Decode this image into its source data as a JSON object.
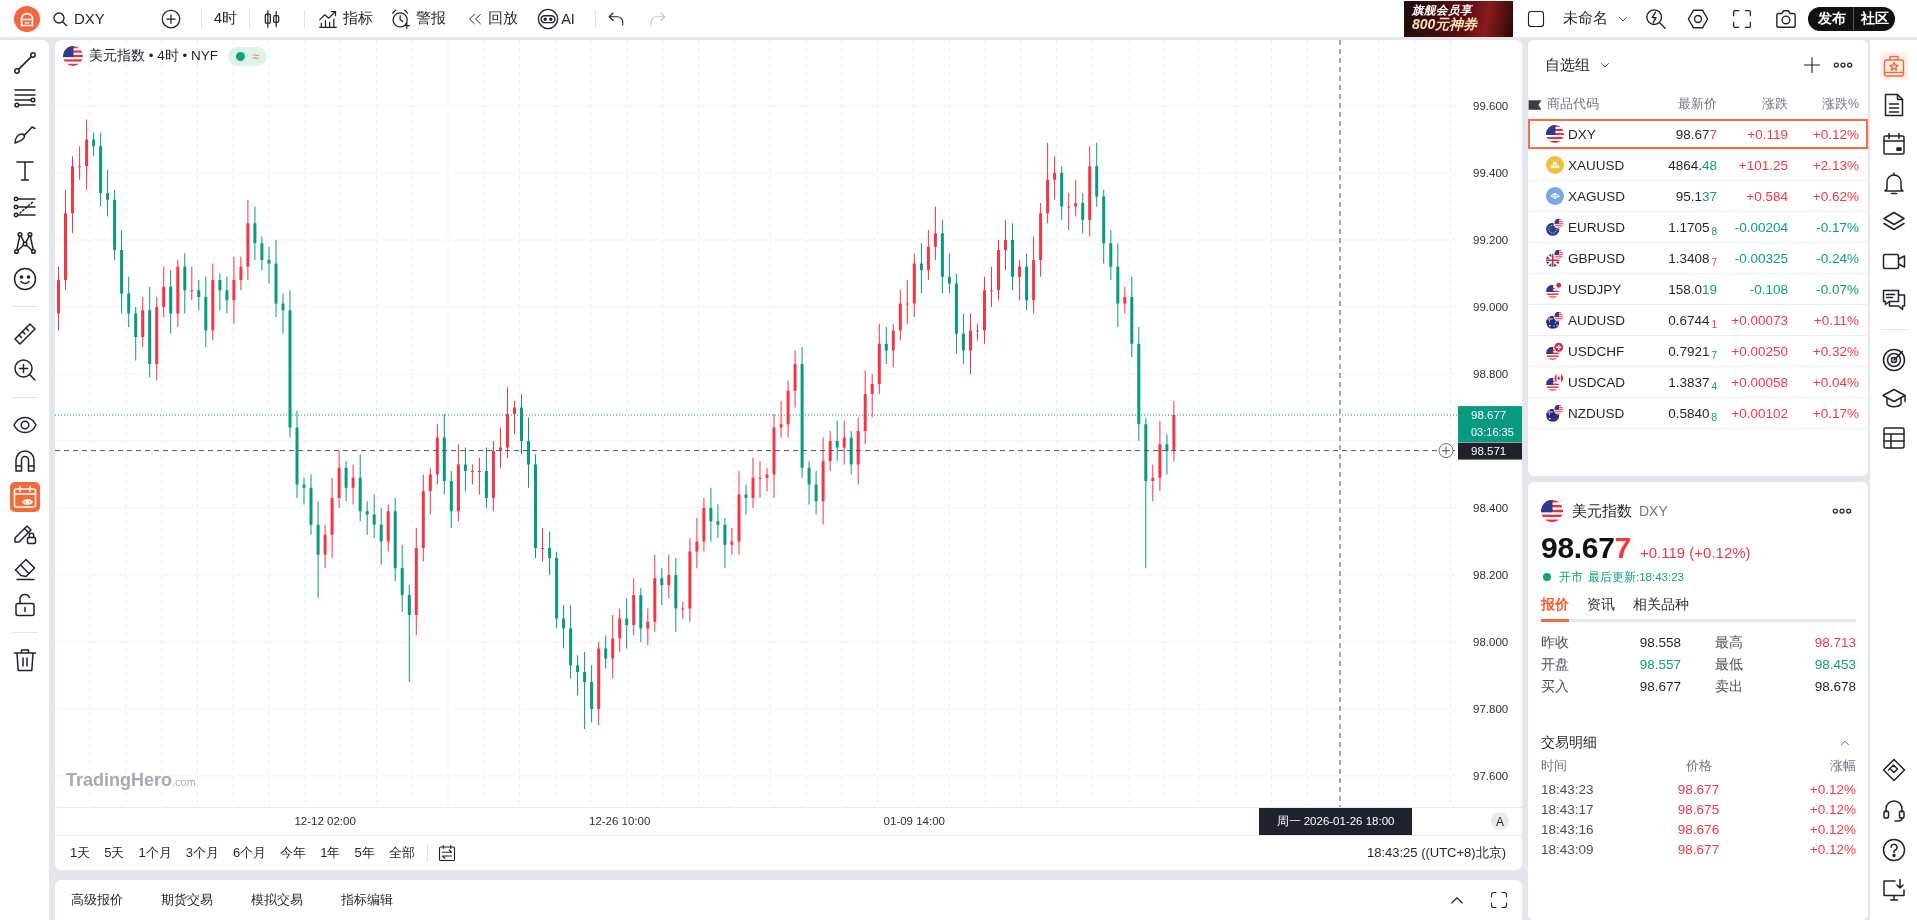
{
  "top_bar": {
    "search": {
      "value": "DXY"
    },
    "interval": "4时",
    "tools": [
      {
        "kind": "indicators",
        "label": "指标"
      },
      {
        "kind": "alerts",
        "label": "警报"
      },
      {
        "kind": "replay",
        "label": "回放"
      },
      {
        "kind": "assistant",
        "label": "AI"
      }
    ],
    "history": [
      {
        "kind": "undo",
        "disabled": false
      },
      {
        "kind": "redo",
        "disabled": true
      }
    ],
    "banner": {
      "line_1": "旗舰会员享",
      "line_2": "800元神券"
    },
    "layout_name": "未命名",
    "actions": [
      "发布",
      "社区"
    ]
  },
  "left_toolbar": {
    "groups": [
      {
        "tools": [
          {
            "kind": "line",
            "selected": false
          },
          {
            "kind": "channels",
            "selected": false
          },
          {
            "kind": "brush",
            "selected": false
          },
          {
            "kind": "text",
            "selected": false
          },
          {
            "kind": "levels",
            "selected": false
          },
          {
            "kind": "pattern",
            "selected": false
          },
          {
            "kind": "emoji",
            "selected": false
          }
        ]
      },
      {
        "tools": [
          {
            "kind": "ruler",
            "selected": false
          },
          {
            "kind": "zoom",
            "selected": false
          }
        ]
      },
      {
        "tools": [
          {
            "kind": "visibility",
            "selected": false
          },
          {
            "kind": "magnet",
            "selected": false
          },
          {
            "kind": "events",
            "selected": true
          },
          {
            "kind": "lockdraw",
            "selected": false
          },
          {
            "kind": "eraser",
            "selected": false
          },
          {
            "kind": "unlock",
            "selected": false
          }
        ]
      },
      {
        "tools": [
          {
            "kind": "trash",
            "selected": false
          }
        ]
      }
    ]
  },
  "chart": {
    "legend": {
      "title": "美元指数 • 4时 • NYF",
      "market_open": true,
      "badge": "≈"
    },
    "brand": "**TradingHero**.com",
    "chart_data": {
      "type": "candlestick",
      "grid": true,
      "categories": [
        null,
        null,
        null,
        null,
        null,
        null,
        null,
        null,
        null,
        null,
        null,
        null,
        null,
        null,
        null,
        null,
        null,
        null,
        null,
        null,
        null,
        null,
        null,
        null,
        null,
        null,
        null,
        null,
        null,
        null,
        null,
        null,
        null,
        null,
        null,
        null,
        null,
        null,
        "12-12 02:00",
        null,
        null,
        null,
        null,
        null,
        null,
        null,
        null,
        null,
        null,
        null,
        null,
        null,
        null,
        null,
        null,
        null,
        null,
        null,
        null,
        null,
        null,
        null,
        null,
        null,
        null,
        null,
        null,
        null,
        null,
        null,
        null,
        null,
        null,
        null,
        null,
        null,
        null,
        null,
        null,
        null,
        "12-26 10:00",
        null,
        null,
        null,
        null,
        null,
        null,
        null,
        null,
        null,
        null,
        null,
        null,
        null,
        null,
        null,
        null,
        null,
        null,
        null,
        null,
        null,
        null,
        null,
        null,
        null,
        null,
        null,
        null,
        null,
        null,
        null,
        null,
        null,
        null,
        null,
        null,
        null,
        null,
        null,
        null,
        null,
        "01-09 14:00",
        null,
        null,
        null,
        null,
        null,
        null,
        null,
        null,
        null,
        null,
        null,
        null,
        null,
        null,
        null,
        null,
        null,
        null,
        null,
        null,
        null,
        null,
        null,
        null,
        null,
        null,
        null,
        null,
        null,
        null,
        null,
        null,
        null,
        null,
        null,
        null,
        null,
        null,
        null,
        null,
        null,
        null,
        null,
        null,
        null,
        null,
        null,
        null,
        null,
        null,
        null,
        null,
        null,
        null,
        null,
        null,
        null,
        null,
        null,
        null,
        null,
        null,
        null,
        null,
        null,
        null,
        null,
        null,
        null,
        null,
        null,
        null,
        null,
        null,
        null,
        null,
        null
      ],
      "ohlc": [
        [
          98.98,
          99.12,
          98.93,
          99.08
        ],
        [
          99.08,
          99.35,
          99.05,
          99.28
        ],
        [
          99.28,
          99.45,
          99.22,
          99.42
        ],
        [
          99.42,
          99.48,
          99.38,
          99.42
        ],
        [
          99.42,
          99.56,
          99.35,
          99.5
        ],
        [
          99.5,
          99.52,
          99.45,
          99.48
        ],
        [
          99.48,
          99.52,
          99.3,
          99.34
        ],
        [
          99.34,
          99.41,
          99.27,
          99.32
        ],
        [
          99.32,
          99.35,
          99.14,
          99.17
        ],
        [
          99.17,
          99.23,
          98.98,
          99.04
        ],
        [
          99.04,
          99.09,
          98.94,
          98.98
        ],
        [
          98.98,
          99.0,
          98.84,
          98.91
        ],
        [
          98.91,
          99.03,
          98.88,
          98.99
        ],
        [
          98.99,
          99.06,
          98.79,
          98.83
        ],
        [
          98.83,
          99.03,
          98.78,
          99.0
        ],
        [
          99.0,
          99.12,
          98.97,
          99.06
        ],
        [
          99.06,
          99.11,
          98.92,
          98.98
        ],
        [
          98.98,
          99.14,
          98.94,
          99.12
        ],
        [
          99.12,
          99.16,
          98.98,
          99.05
        ],
        [
          99.05,
          99.12,
          99.02,
          99.05
        ],
        [
          99.05,
          99.08,
          98.99,
          99.03
        ],
        [
          99.03,
          99.09,
          98.88,
          98.93
        ],
        [
          98.93,
          99.13,
          98.9,
          99.08
        ],
        [
          99.08,
          99.1,
          98.99,
          99.05
        ],
        [
          99.05,
          99.09,
          98.98,
          99.02
        ],
        [
          99.02,
          99.15,
          98.95,
          99.08
        ],
        [
          99.08,
          99.15,
          99.05,
          99.12
        ],
        [
          99.12,
          99.32,
          99.08,
          99.25
        ],
        [
          99.25,
          99.3,
          99.14,
          99.19
        ],
        [
          99.19,
          99.21,
          99.11,
          99.14
        ],
        [
          99.14,
          99.18,
          99.07,
          99.13
        ],
        [
          99.13,
          99.2,
          98.97,
          99.01
        ],
        [
          99.01,
          99.04,
          98.92,
          98.99
        ],
        [
          98.99,
          99.05,
          98.61,
          98.64
        ],
        [
          98.64,
          98.69,
          98.43,
          98.47
        ],
        [
          98.47,
          98.49,
          98.41,
          98.46
        ],
        [
          98.46,
          98.5,
          98.32,
          98.35
        ],
        [
          98.35,
          98.42,
          98.13,
          98.26
        ],
        [
          98.26,
          98.35,
          98.22,
          98.32
        ],
        [
          98.32,
          98.49,
          98.25,
          98.43
        ],
        [
          98.43,
          98.57,
          98.4,
          98.52
        ],
        [
          98.52,
          98.54,
          98.42,
          98.46
        ],
        [
          98.46,
          98.53,
          98.41,
          98.49
        ],
        [
          98.49,
          98.56,
          98.36,
          98.39
        ],
        [
          98.39,
          98.42,
          98.32,
          98.38
        ],
        [
          98.38,
          98.44,
          98.31,
          98.35
        ],
        [
          98.35,
          98.4,
          98.23,
          98.3
        ],
        [
          98.3,
          98.41,
          98.27,
          98.39
        ],
        [
          98.39,
          98.43,
          98.18,
          98.22
        ],
        [
          98.22,
          98.29,
          98.09,
          98.14
        ],
        [
          98.14,
          98.17,
          97.88,
          98.08
        ],
        [
          98.08,
          98.34,
          98.02,
          98.28
        ],
        [
          98.28,
          98.5,
          98.24,
          98.45
        ],
        [
          98.45,
          98.52,
          98.38,
          98.5
        ],
        [
          98.5,
          98.65,
          98.47,
          98.61
        ],
        [
          98.61,
          98.68,
          98.44,
          98.48
        ],
        [
          98.48,
          98.51,
          98.34,
          98.39
        ],
        [
          98.39,
          98.59,
          98.36,
          98.53
        ],
        [
          98.53,
          98.58,
          98.45,
          98.51
        ],
        [
          98.51,
          98.53,
          98.47,
          98.51
        ],
        [
          98.51,
          98.55,
          98.44,
          98.51
        ],
        [
          98.51,
          98.58,
          98.4,
          98.43
        ],
        [
          98.43,
          98.6,
          98.39,
          98.57
        ],
        [
          98.57,
          98.64,
          98.52,
          98.58
        ],
        [
          98.58,
          98.76,
          98.55,
          98.68
        ],
        [
          98.68,
          98.72,
          98.62,
          98.7
        ],
        [
          98.7,
          98.74,
          98.56,
          98.6
        ],
        [
          98.6,
          98.67,
          98.46,
          98.53
        ],
        [
          98.53,
          98.56,
          98.25,
          98.28
        ],
        [
          98.28,
          98.34,
          98.24,
          98.28
        ],
        [
          98.28,
          98.33,
          98.2,
          98.25
        ],
        [
          98.25,
          98.27,
          98.04,
          98.07
        ],
        [
          98.07,
          98.11,
          97.98,
          98.04
        ],
        [
          98.04,
          98.11,
          97.89,
          97.93
        ],
        [
          97.93,
          97.96,
          97.84,
          97.91
        ],
        [
          97.91,
          97.97,
          97.74,
          97.88
        ],
        [
          97.88,
          97.93,
          97.76,
          97.8
        ],
        [
          97.8,
          98.0,
          97.75,
          97.98
        ],
        [
          97.98,
          98.02,
          97.92,
          97.95
        ],
        [
          97.95,
          98.08,
          97.89,
          98.01
        ],
        [
          98.01,
          98.1,
          97.97,
          98.07
        ],
        [
          98.07,
          98.13,
          97.98,
          98.05
        ],
        [
          98.05,
          98.19,
          98.02,
          98.14
        ],
        [
          98.14,
          98.16,
          98.0,
          98.04
        ],
        [
          98.04,
          98.1,
          97.99,
          98.06
        ],
        [
          98.06,
          98.26,
          98.03,
          98.19
        ],
        [
          98.19,
          98.22,
          98.11,
          98.17
        ],
        [
          98.17,
          98.26,
          98.13,
          98.2
        ],
        [
          98.2,
          98.25,
          98.03,
          98.1
        ],
        [
          98.1,
          98.12,
          98.07,
          98.1
        ],
        [
          98.1,
          98.31,
          98.06,
          98.27
        ],
        [
          98.27,
          98.37,
          98.22,
          98.3
        ],
        [
          98.3,
          98.43,
          98.27,
          98.4
        ],
        [
          98.4,
          98.46,
          98.3,
          98.36
        ],
        [
          98.36,
          98.41,
          98.31,
          98.35
        ],
        [
          98.35,
          98.37,
          98.22,
          98.29
        ],
        [
          98.29,
          98.34,
          98.26,
          98.3
        ],
        [
          98.3,
          98.51,
          98.26,
          98.44
        ],
        [
          98.44,
          98.47,
          98.38,
          98.43
        ],
        [
          98.43,
          98.55,
          98.4,
          98.49
        ],
        [
          98.49,
          98.54,
          98.43,
          98.49
        ],
        [
          98.49,
          98.52,
          98.45,
          98.5
        ],
        [
          98.5,
          98.68,
          98.43,
          98.64
        ],
        [
          98.64,
          98.72,
          98.61,
          98.65
        ],
        [
          98.65,
          98.78,
          98.61,
          98.75
        ],
        [
          98.75,
          98.87,
          98.7,
          98.83
        ],
        [
          98.83,
          98.88,
          98.49,
          98.52
        ],
        [
          98.52,
          98.54,
          98.41,
          98.47
        ],
        [
          98.47,
          98.51,
          98.38,
          98.42
        ],
        [
          98.42,
          98.61,
          98.35,
          98.54
        ],
        [
          98.54,
          98.63,
          98.51,
          98.6
        ],
        [
          98.6,
          98.66,
          98.54,
          98.58
        ],
        [
          98.58,
          98.66,
          98.53,
          98.61
        ],
        [
          98.61,
          98.63,
          98.5,
          98.53
        ],
        [
          98.53,
          98.67,
          98.47,
          98.63
        ],
        [
          98.63,
          98.81,
          98.59,
          98.74
        ],
        [
          98.74,
          98.8,
          98.67,
          98.77
        ],
        [
          98.77,
          98.95,
          98.74,
          98.89
        ],
        [
          98.89,
          98.94,
          98.83,
          98.87
        ],
        [
          98.87,
          98.95,
          98.82,
          98.93
        ],
        [
          98.93,
          99.05,
          98.9,
          99.01
        ],
        [
          99.01,
          99.08,
          98.95,
          99.01
        ],
        [
          99.01,
          99.16,
          98.97,
          99.13
        ],
        [
          99.13,
          99.19,
          99.04,
          99.11
        ],
        [
          99.11,
          99.23,
          99.08,
          99.18
        ],
        [
          99.18,
          99.3,
          99.14,
          99.22
        ],
        [
          99.22,
          99.26,
          99.04,
          99.09
        ],
        [
          99.09,
          99.16,
          99.04,
          99.07
        ],
        [
          99.07,
          99.1,
          98.86,
          98.92
        ],
        [
          98.92,
          98.98,
          98.83,
          98.87
        ],
        [
          98.87,
          98.98,
          98.8,
          98.93
        ],
        [
          98.93,
          98.95,
          98.9,
          98.93
        ],
        [
          98.93,
          99.09,
          98.89,
          99.05
        ],
        [
          99.05,
          99.12,
          99.0,
          99.05
        ],
        [
          99.05,
          99.2,
          99.02,
          99.17
        ],
        [
          99.17,
          99.26,
          99.11,
          99.2
        ],
        [
          99.2,
          99.25,
          99.05,
          99.09
        ],
        [
          99.09,
          99.14,
          99.02,
          99.12
        ],
        [
          99.12,
          99.16,
          98.99,
          99.02
        ],
        [
          99.02,
          99.21,
          98.98,
          99.14
        ],
        [
          99.14,
          99.31,
          99.09,
          99.28
        ],
        [
          99.28,
          99.49,
          99.25,
          99.38
        ],
        [
          99.38,
          99.45,
          99.32,
          99.4
        ],
        [
          99.4,
          99.42,
          99.26,
          99.3
        ],
        [
          99.3,
          99.34,
          99.23,
          99.3
        ],
        [
          99.3,
          99.38,
          99.27,
          99.31
        ],
        [
          99.31,
          99.34,
          99.22,
          99.26
        ],
        [
          99.26,
          99.48,
          99.21,
          99.42
        ],
        [
          99.42,
          99.49,
          99.3,
          99.33
        ],
        [
          99.33,
          99.35,
          99.13,
          99.19
        ],
        [
          99.19,
          99.23,
          99.08,
          99.12
        ],
        [
          99.12,
          99.19,
          98.94,
          99.01
        ],
        [
          99.01,
          99.06,
          98.98,
          99.03
        ],
        [
          99.03,
          99.09,
          98.85,
          98.89
        ],
        [
          98.89,
          98.94,
          98.6,
          98.65
        ],
        [
          98.65,
          98.67,
          98.22,
          98.48
        ],
        [
          98.48,
          98.53,
          98.42,
          98.49
        ],
        [
          98.49,
          98.66,
          98.45,
          98.59
        ],
        [
          98.59,
          98.62,
          98.5,
          98.57
        ],
        [
          98.57,
          98.72,
          98.54,
          98.677
        ],
        null,
        null,
        null,
        null,
        null,
        null,
        null,
        null,
        null,
        null,
        null,
        null,
        null,
        null,
        null,
        null,
        null,
        null,
        null,
        null,
        null,
        null,
        null,
        null,
        null,
        null,
        null,
        null,
        null,
        null,
        null,
        null,
        null,
        null,
        null,
        null,
        null,
        null,
        null,
        null
      ],
      "ylim": [
        97.507,
        99.797
      ],
      "yticks": [
        {
          "value": 99.6,
          "label": "99.600"
        },
        {
          "value": 99.4,
          "label": "99.400"
        },
        {
          "value": 99.2,
          "label": "99.200"
        },
        {
          "value": 99.0,
          "label": "99.000"
        },
        {
          "value": 98.8,
          "label": "98.800"
        },
        {
          "value": 98.4,
          "label": "98.400"
        },
        {
          "value": 98.2,
          "label": "98.200"
        },
        {
          "value": 98.0,
          "label": "98.000"
        },
        {
          "value": 97.8,
          "label": "97.800"
        },
        {
          "value": 97.6,
          "label": "97.600"
        }
      ],
      "ref_lines": [
        {
          "axis": "y",
          "value": 98.677,
          "color": "#089981"
        },
        {
          "axis": "y",
          "value": 98.571,
          "color": "#50535e"
        }
      ]
    },
    "last_price": {
      "value": "98.677",
      "countdown": "03:16:35"
    },
    "crosshair": {
      "price": "98.571",
      "time": "周一 2026-01-26 18:00"
    },
    "auto_scale": "A"
  },
  "range_bar": {
    "ranges": [
      "1天",
      "5天",
      "1个月",
      "3个月",
      "6个月",
      "今年",
      "1年",
      "5年",
      "全部"
    ],
    "clock": "18:43:25 ((UTC+8)北京)"
  },
  "bottom_panel": {
    "tabs": [
      "高级报价",
      "期货交易",
      "模拟交易",
      "指标编辑"
    ]
  },
  "watchlist": {
    "group": "自选组",
    "columns": [
      "商品代码",
      "最新价",
      "涨跌",
      "涨跌%"
    ],
    "rows": [
      {
        "symbol": "DXY",
        "price": "98.67",
        "tail": "7",
        "tick_up": true,
        "change": "+0.119",
        "change_pct": "+0.12%",
        "rising": true,
        "selected": true
      },
      {
        "symbol": "XAUUSD",
        "price": "4864.",
        "tail": "48",
        "tick_up": false,
        "change": "+101.25",
        "change_pct": "+2.13%",
        "rising": true,
        "selected": false
      },
      {
        "symbol": "XAGUSD",
        "price": "95.1",
        "tail": "37",
        "tick_up": false,
        "change": "+0.584",
        "change_pct": "+0.62%",
        "rising": true,
        "selected": false
      },
      {
        "symbol": "EURUSD",
        "price": "1.1705",
        "tail": "$_{8}$",
        "tick_up": false,
        "change": "-0.00204",
        "change_pct": "-0.17%",
        "rising": false,
        "selected": false
      },
      {
        "symbol": "GBPUSD",
        "price": "1.3408",
        "tail": "$_{7}$",
        "tick_up": true,
        "change": "-0.00325",
        "change_pct": "-0.24%",
        "rising": false,
        "selected": false
      },
      {
        "symbol": "USDJPY",
        "price": "158.0",
        "tail": "19",
        "tick_up": false,
        "change": "-0.108",
        "change_pct": "-0.07%",
        "rising": false,
        "selected": false
      },
      {
        "symbol": "AUDUSD",
        "price": "0.6744",
        "tail": "$_{1}$",
        "tick_up": true,
        "change": "+0.00073",
        "change_pct": "+0.11%",
        "rising": true,
        "selected": false
      },
      {
        "symbol": "USDCHF",
        "price": "0.7921",
        "tail": "$_{7}$",
        "tick_up": false,
        "change": "+0.00250",
        "change_pct": "+0.32%",
        "rising": true,
        "selected": false
      },
      {
        "symbol": "USDCAD",
        "price": "1.3837",
        "tail": "$_{4}$",
        "tick_up": false,
        "change": "+0.00058",
        "change_pct": "+0.04%",
        "rising": true,
        "selected": false
      },
      {
        "symbol": "NZDUSD",
        "price": "0.5840",
        "tail": "$_{8}$",
        "tick_up": false,
        "change": "+0.00102",
        "change_pct": "+0.17%",
        "rising": true,
        "selected": false
      }
    ]
  },
  "detail": {
    "name": "美元指数",
    "symbol": "DXY",
    "price": "98.67",
    "price_tail": "7",
    "tick_up": true,
    "change": "+0.119 (+0.12%)",
    "rising": true,
    "market_open": true,
    "market_status": "开市",
    "updated": "最后更新:18:43:23",
    "tabs": [
      {
        "label": "报价",
        "selected": true
      },
      {
        "label": "资讯",
        "selected": false
      },
      {
        "label": "相关品种",
        "selected": false
      }
    ],
    "quote": [
      {
        "label": "昨收",
        "value": "98.558",
        "color": "#1f2329"
      },
      {
        "label": "最高",
        "value": "98.713",
        "color": "#f23645"
      },
      {
        "label": "开盘",
        "value": "98.557",
        "color": "#0a9e7e"
      },
      {
        "label": "最低",
        "value": "98.453",
        "color": "#0a9e7e"
      },
      {
        "label": "买入",
        "value": "98.677",
        "color": "#1f2329"
      },
      {
        "label": "卖出",
        "value": "98.678",
        "color": "#1f2329"
      }
    ],
    "trades": {
      "title": "交易明细",
      "expanded": true,
      "columns": [
        "时间",
        "价格",
        "涨幅"
      ],
      "rows": [
        {
          "time": "18:43:23",
          "price": "98.677",
          "change": "+0.12%",
          "rising": true
        },
        {
          "time": "18:43:17",
          "price": "98.675",
          "change": "+0.12%",
          "rising": true
        },
        {
          "time": "18:43:16",
          "price": "98.676",
          "change": "+0.12%",
          "rising": true
        },
        {
          "time": "18:43:09",
          "price": "98.677",
          "change": "+0.12%",
          "rising": true
        }
      ]
    }
  },
  "right_rail": {
    "top": [
      {
        "items": [
          {
            "kind": "watchlist",
            "selected": true
          },
          {
            "kind": "notes",
            "selected": false
          },
          {
            "kind": "calendar",
            "selected": false
          },
          {
            "kind": "alerts",
            "selected": false
          },
          {
            "kind": "layers",
            "selected": false
          },
          {
            "kind": "video",
            "selected": false
          },
          {
            "kind": "chat",
            "selected": false
          }
        ]
      },
      {
        "items": [
          {
            "kind": "target",
            "selected": false
          },
          {
            "kind": "learn",
            "selected": false
          },
          {
            "kind": "table",
            "selected": false
          }
        ]
      }
    ],
    "bottom": {
      "items": [
        {
          "kind": "partner",
          "selected": false
        },
        {
          "kind": "support",
          "selected": false
        },
        {
          "kind": "help",
          "selected": false
        },
        {
          "kind": "download",
          "selected": false
        }
      ]
    }
  }
}
